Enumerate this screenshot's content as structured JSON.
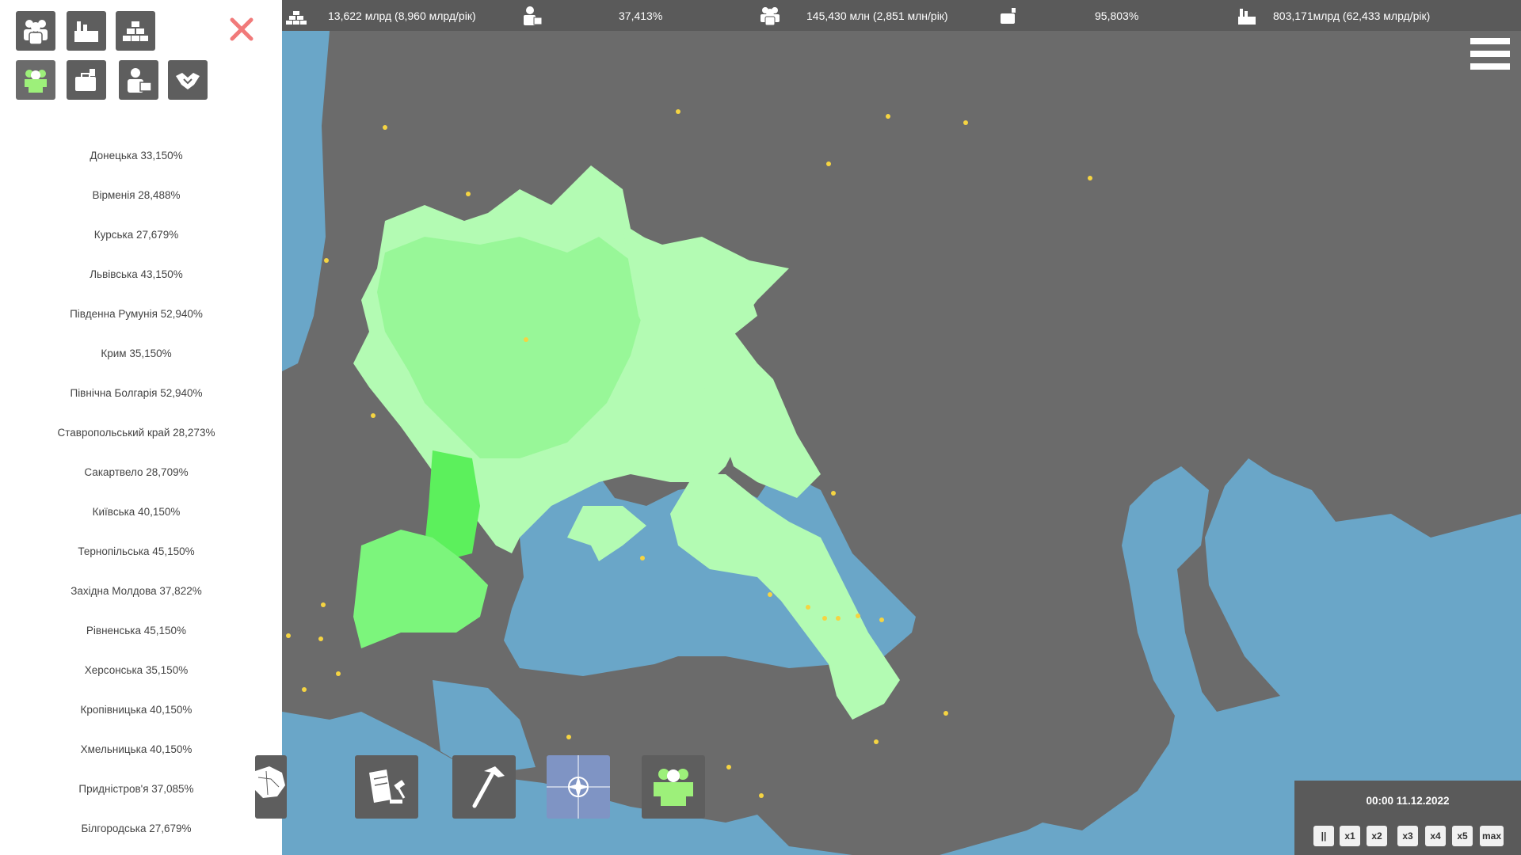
{
  "regions": [
    "Донецька 33,150%",
    "Вірменія 28,488%",
    "Курська 27,679%",
    "Львівська 43,150%",
    "Південна Румунія 52,940%",
    "Крим 35,150%",
    "Північна Болгарія 52,940%",
    "Ставропольський край 28,273%",
    "Сакартвело 28,709%",
    "Київська 40,150%",
    "Тернопільська 45,150%",
    "Західна Молдова 37,822%",
    "Рівненська 45,150%",
    "Херсонська 35,150%",
    "Кропівницька 40,150%",
    "Хмельницька 40,150%",
    "Придністров'я 37,085%",
    "Білгородська 27,679%"
  ],
  "stats": {
    "gdp": "13,622 млрд (8,960 млрд/рік)",
    "unemployment": "37,413%",
    "population": "145,430 млн (2,851 млн/рік)",
    "budget": "95,803%",
    "industry": "803,171млрд (62,433 млрд/рік)"
  },
  "time": {
    "label": "00:00 11.12.2022",
    "speeds": [
      "||",
      "x1",
      "x2",
      "x3",
      "x4",
      "x5",
      "max"
    ]
  },
  "colors": {
    "accent_close": "#f17a7a",
    "panel": "#5a5a5a",
    "sea": "#6aa6c8",
    "land": "#6b6b6b",
    "region_light": "#b3fbb3",
    "region_mid": "#98f798",
    "region_strong": "#5cf05c",
    "city_star": "#f5d442"
  },
  "icons": {
    "categories": [
      "people-icon",
      "factory-icon",
      "gold-bars-icon",
      "workers-icon",
      "briefcase-icon",
      "person-briefcase-icon",
      "handshake-icon"
    ],
    "tools": [
      "map-regions-icon",
      "law-gavel-icon",
      "hammer-icon",
      "nato-icon",
      "workers-icon"
    ]
  }
}
